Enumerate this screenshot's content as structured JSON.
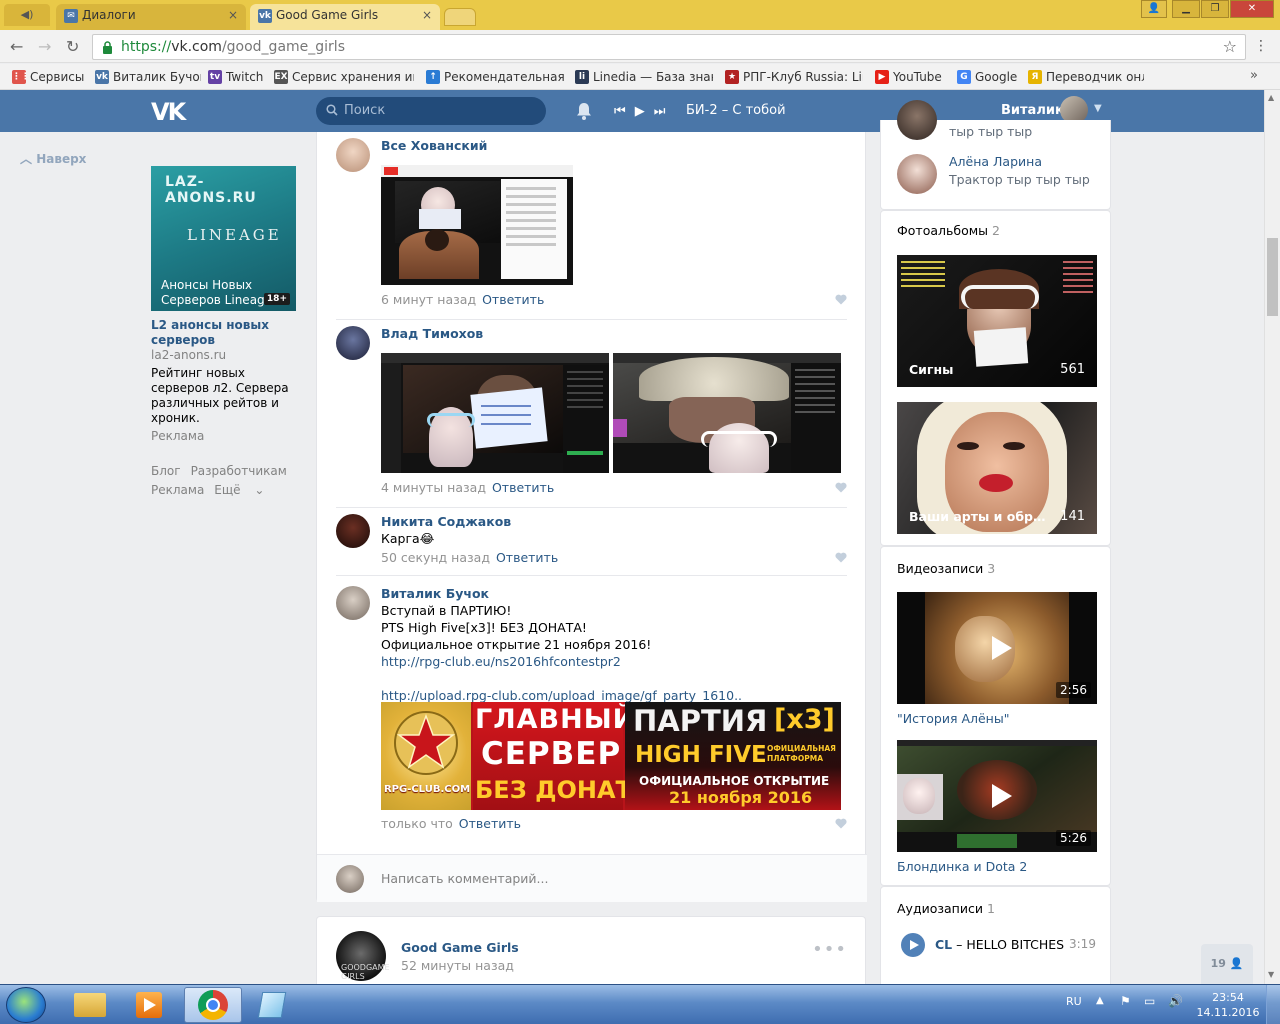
{
  "browser": {
    "pinned_tab_icon": "speaker-icon",
    "tabs": [
      {
        "title": "Диалоги",
        "close": "×"
      },
      {
        "title": "Good Game Girls",
        "close": "×"
      }
    ],
    "url": {
      "protocol": "https://",
      "host": "vk.com",
      "path": "/good_game_girls"
    }
  },
  "bookmarks": [
    {
      "label": "Сервисы",
      "icon": "apps-grid-icon",
      "color": "#e0554c"
    },
    {
      "label": "Виталик Бучок",
      "icon": "vk-icon",
      "color": "#4a76a8"
    },
    {
      "label": "Twitch",
      "icon": "twitch-icon",
      "color": "#6441a5"
    },
    {
      "label": "Сервис хранения ин",
      "icon": "ex-icon",
      "color": "#555555"
    },
    {
      "label": "Рекомендательная с",
      "icon": "arrow-up-icon",
      "color": "#2a7bd4"
    },
    {
      "label": "Linedia — База знани",
      "icon": "linedia-icon",
      "color": "#2b3a55"
    },
    {
      "label": "РПГ-Клуб Russia: Line",
      "icon": "rpg-club-icon",
      "color": "#b22222"
    },
    {
      "label": "YouTube",
      "icon": "youtube-icon",
      "color": "#e62117"
    },
    {
      "label": "Google",
      "icon": "google-icon",
      "color": "#4285f4"
    },
    {
      "label": "Переводчик онлайн",
      "icon": "translator-icon",
      "color": "#e6b400"
    }
  ],
  "vk_header": {
    "logo": "VK",
    "search_placeholder": "Поиск",
    "now_playing": "БИ-2 – С тобой",
    "user_name": "Виталик"
  },
  "left": {
    "top_button": "Наверх",
    "ad": {
      "image_site": "LAZ-ANONS.RU",
      "image_logo": "LINEAGE",
      "image_caption": "Анонсы Новых Серверов Lineage",
      "age_badge": "18+",
      "title": "L2 анонсы новых серверов",
      "domain": "la2-anons.ru",
      "description": "Рейтинг новых серверов л2. Сервера различных рейтов и хроник.",
      "label": "Реклама"
    },
    "footer_links": [
      "Блог",
      "Разработчикам",
      "Реклама",
      "Ещё"
    ]
  },
  "feed": {
    "comments": [
      {
        "author": "Все Хованский",
        "time": "6 минут назад",
        "reply": "Ответить"
      },
      {
        "author": "Влад Тимохов",
        "time": "4 минуты назад",
        "reply": "Ответить"
      },
      {
        "author": "Никита Соджаков",
        "text": "Карга😂",
        "time": "50 секунд назад",
        "reply": "Ответить"
      },
      {
        "author": "Виталик Бучок",
        "lines": [
          "Вступай в ПАРТИЮ!",
          "PTS High Five[x3]! БЕЗ ДОНАТА!",
          "Официальное открытие 21 ноября 2016!"
        ],
        "link1": "http://rpg-club.eu/ns2016hfcontestpr2",
        "link2": "http://upload.rpg-club.com/upload_image/gf_party_1610..",
        "time": "только что",
        "reply": "Ответить"
      }
    ],
    "banner": {
      "logo_text": "RPG-CLUB.COM",
      "line1": "ГЛАВНЫЙ",
      "line2": "СЕРВЕР",
      "line3": "БЕЗ ДОНАТА",
      "right1": "ПАРТИЯ",
      "right_x": "[x3]",
      "right2": "HIGH FIVE",
      "right_note": "ОФИЦИАЛЬНАЯ ПЛАТФОРМА",
      "right3": "ОФИЦИАЛЬНОЕ ОТКРЫТИЕ",
      "right4": "21 ноября 2016"
    },
    "comment_placeholder": "Написать комментарий...",
    "next_post": {
      "author": "Good Game Girls",
      "time": "52 минуты назад",
      "avatar_text": "GOODGAME GIRLS"
    }
  },
  "right": {
    "friends": [
      {
        "name": "",
        "subtitle": "тыр тыр тыр"
      },
      {
        "name": "Алёна Ларина",
        "subtitle": "Трактор тыр тыр тыр"
      }
    ],
    "albums": {
      "heading": "Фотоальбомы",
      "count": "2",
      "items": [
        {
          "title": "Сигны",
          "count": "561"
        },
        {
          "title": "Ваши арты и обработки",
          "count": "141"
        }
      ]
    },
    "videos": {
      "heading": "Видеозаписи",
      "count": "3",
      "items": [
        {
          "title": "\"История Алёны\"",
          "duration": "2:56"
        },
        {
          "title": "Блондинка и Dota 2",
          "duration": "5:26"
        }
      ]
    },
    "audio": {
      "heading": "Аудиозаписи",
      "count": "1",
      "items": [
        {
          "artist": "CL",
          "title": "HELLO BITCHES",
          "duration": "3:19"
        }
      ]
    },
    "online_count": "19"
  },
  "taskbar": {
    "language": "RU",
    "time": "23:54",
    "date": "14.11.2016"
  }
}
